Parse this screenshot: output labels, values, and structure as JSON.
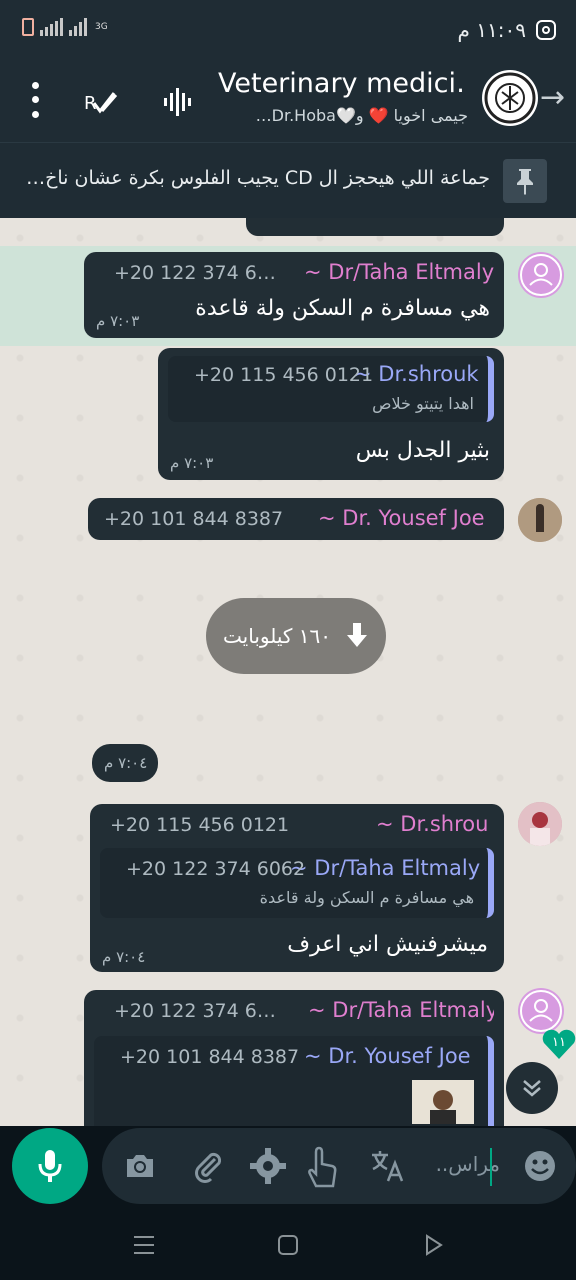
{
  "status_bar": {
    "time": "١١:٠٩ م",
    "network": "3G"
  },
  "header": {
    "title": "Veterinary medici…",
    "subtitle": "جيمى اخويا ❤️ و🤍Dr.Hoba…"
  },
  "pinned": {
    "text": "جماعة اللي هيحجز ال CD يجيب الفلوس بكرة عشان ناخ…"
  },
  "messages": [
    {
      "sender": "~ Dr/Taha Eltmaly",
      "phone": "+20 122 374 6…",
      "text": "هي مسافرة م السكن ولة قاعدة",
      "time": "٧:٠٣ م"
    },
    {
      "sender": "~ Dr.shrouk",
      "phone": "+20 115 456 0121",
      "quote_text": "اهدا يتيتو خلاص",
      "text": "بثير الجدل بس",
      "time": "٧:٠٣ م"
    },
    {
      "sender": "~ Dr. Yousef Joe",
      "phone": "+20 101 844 8387"
    },
    {
      "download_label": "١٦٠ كيلوبايت"
    },
    {
      "time": "٧:٠٤ م"
    },
    {
      "sender": "~ Dr.shrouk",
      "phone": "+20 115 456 0121",
      "quote_sender": "~ Dr/Taha Eltmaly",
      "quote_phone": "+20 122 374 6062",
      "quote_text": "هي مسافرة م السكن ولة قاعدة",
      "text": "ميشرفنيش اني اعرف",
      "time": "٧:٠٤ م"
    },
    {
      "sender": "~ Dr/Taha Eltmaly",
      "phone": "+20 122 374 6…",
      "quote_sender": "~ Dr. Yousef Joe",
      "quote_phone": "+20 101 844 8387"
    }
  ],
  "unread_count": "١١",
  "input": {
    "placeholder": "مراس.."
  },
  "colors": {
    "accent": "#00a884",
    "bubble": "#222e35",
    "sender_pink": "#e07fcf",
    "sender_purple": "#9aa8f7"
  }
}
